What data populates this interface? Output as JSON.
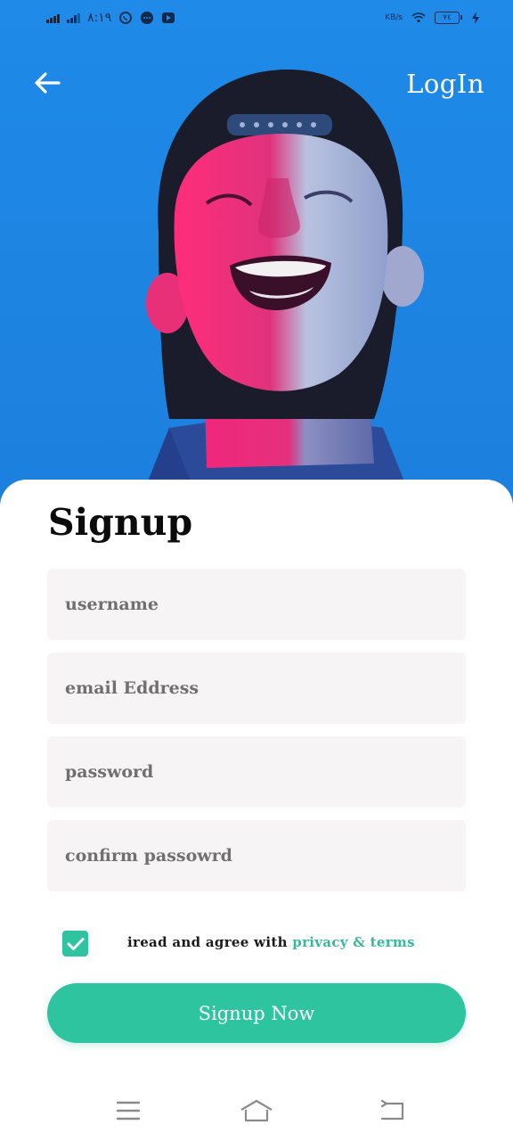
{
  "status_bar": {
    "time": "٨:١٩",
    "network_speed": "KB/s",
    "battery_level": "٧٤"
  },
  "header": {
    "back_icon": "arrow-left-icon",
    "login_label": "LogIn"
  },
  "form": {
    "title": "Signup",
    "username_placeholder": "username",
    "email_placeholder": "email Eddress",
    "password_placeholder": "password",
    "confirm_placeholder": "confirm passowrd",
    "agree_checked": true,
    "agree_prefix": "iread and agree with ",
    "terms_label": "privacy & terms",
    "submit_label": "Signup Now"
  },
  "colors": {
    "accent": "#2ec4a0",
    "hero_bg": "#1e8be6",
    "field_bg": "#f6f4f5"
  },
  "system_nav": {
    "menu_icon": "menu-icon",
    "home_icon": "home-icon",
    "back_icon": "back-icon"
  }
}
